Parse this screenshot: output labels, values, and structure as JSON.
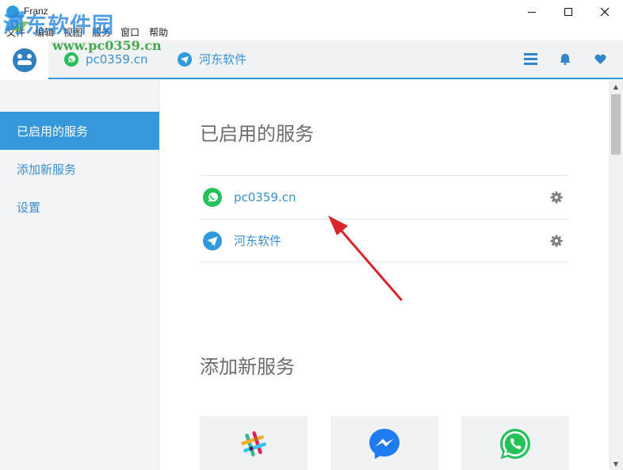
{
  "window": {
    "title": "Franz",
    "minimize_icon": "minimize-icon",
    "maximize_icon": "maximize-icon",
    "close_icon": "close-icon"
  },
  "watermark": {
    "text": "河东软件园",
    "url": "www.pc0359.cn"
  },
  "menubar": {
    "items": [
      "文件",
      "编辑",
      "视图",
      "服务",
      "窗口",
      "帮助"
    ]
  },
  "tabbar": {
    "tabs": [
      {
        "label": "pc0359.cn",
        "icon": "whatsapp-icon"
      },
      {
        "label": "河东软件",
        "icon": "telegram-icon"
      }
    ],
    "right_icons": [
      "menu-icon",
      "bell-icon",
      "heart-icon"
    ]
  },
  "sidebar": {
    "items": [
      {
        "label": "已启用的服务",
        "active": true
      },
      {
        "label": "添加新服务",
        "active": false
      },
      {
        "label": "设置",
        "active": false
      }
    ]
  },
  "main": {
    "enabled_title": "已启用的服务",
    "services": [
      {
        "name": "pc0359.cn",
        "icon": "whatsapp-icon"
      },
      {
        "name": "河东软件",
        "icon": "telegram-icon"
      }
    ],
    "add_title": "添加新服务",
    "add_cards": [
      {
        "icon": "slack-icon"
      },
      {
        "icon": "messenger-icon"
      },
      {
        "icon": "whatsapp-icon"
      }
    ]
  },
  "colors": {
    "accent": "#3498db",
    "link": "#3a8fd1",
    "whatsapp": "#25c15b",
    "telegram": "#2e9be0",
    "messenger": "#1f7cf0",
    "annotation_arrow": "#d9262b"
  }
}
